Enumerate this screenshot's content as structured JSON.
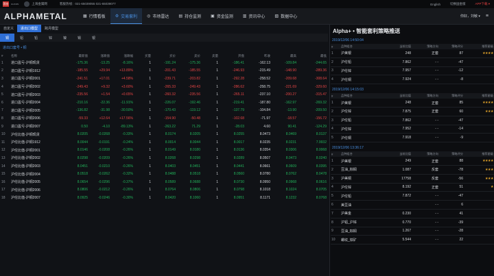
{
  "topbar": {
    "company1": "国金",
    "company1_sub": "GUOJIN",
    "company2": "上海金属网",
    "hotline": "客服热线：021-65039055 021-65039077",
    "lang": "English",
    "switch": "切换国金版",
    "app": "APP下载 ▾"
  },
  "brand": "ALPHAMETAL",
  "nav": [
    {
      "label": "行情看板",
      "icon": "▦"
    },
    {
      "label": "交易套利",
      "icon": "⚙",
      "active": true
    },
    {
      "label": "市场雷达",
      "icon": "◎"
    },
    {
      "label": "持仓监测",
      "icon": "▤"
    },
    {
      "label": "资金监测",
      "icon": "▣"
    },
    {
      "label": "资讯中心",
      "icon": "▥"
    },
    {
      "label": "数据中心",
      "icon": "▧"
    }
  ],
  "user": {
    "greeting": "你好，刘敏 ▾",
    "menu": "≡"
  },
  "tabs1": [
    {
      "label": "自定义"
    },
    {
      "label": "进出口模型",
      "active": true
    },
    {
      "label": "跨月模型"
    }
  ],
  "tabs2": [
    {
      "label": "铜",
      "active": true
    },
    {
      "label": "铝"
    },
    {
      "label": "铅"
    },
    {
      "label": "锌"
    },
    {
      "label": "镍"
    },
    {
      "label": "锡"
    },
    {
      "label": "银"
    }
  ],
  "breadcrumb": "进出口套号 • 铜",
  "table": {
    "headers": [
      "#",
      "名称",
      "最新值",
      "涨跌值",
      "涨跌幅",
      "买量",
      "买价",
      "卖价",
      "卖量",
      "开盘",
      "昨收",
      "最高",
      "最低"
    ],
    "rows": [
      [
        "1",
        "进口盈亏-沪铜现货",
        "-175.36",
        "-13.25",
        "-8.16%",
        "1",
        "-191.24",
        "-175.36",
        "1",
        "-186.41",
        "-162.13",
        "-109.84",
        "-244.65"
      ],
      [
        "2",
        "进口盈亏-沪铜1912",
        "-185.55",
        "+29.94",
        "+13.89%",
        "1",
        "-201.43",
        "-185.55",
        "1",
        "-246.93",
        "-215.49",
        "-148.90",
        "-289.36"
      ],
      [
        "3",
        "进口盈亏-沪铜2001",
        "-241.51",
        "+17.01",
        "+4.58%",
        "1",
        "-239.71",
        "-203.82",
        "1",
        "-292.28",
        "-258.52",
        "-209.68",
        "-308.64"
      ],
      [
        "4",
        "进口盈亏-沪铜2002",
        "-249.43",
        "+9.32",
        "+3.60%",
        "1",
        "-265.33",
        "-249.43",
        "1",
        "-286.62",
        "-258.75",
        "-221.69",
        "-329.60"
      ],
      [
        "5",
        "进口盈亏-沪铜2003",
        "-235.56",
        "+1.54",
        "+0.65%",
        "1",
        "-260.32",
        "-235.56",
        "1",
        "-265.11",
        "-237.10",
        "-200.27",
        "-315.47"
      ],
      [
        "6",
        "进口盈亏-沪铜2004",
        "-210.16",
        "-22.36",
        "-11.91%",
        "1",
        "-226.07",
        "-192.46",
        "1",
        "-219.41",
        "-187.80",
        "-162.97",
        "-269.32"
      ],
      [
        "7",
        "进口盈亏-沪铜2005",
        "-136.82",
        "-31.98",
        "-30.50%",
        "1",
        "-170.43",
        "-119.12",
        "1",
        "-137.79",
        "-104.84",
        "-13.90",
        "-209.50"
      ],
      [
        "8",
        "进口盈亏-沪铜2006",
        "-59.33",
        "+12.64",
        "+17.56%",
        "1",
        "-154.90",
        "-50.48",
        "1",
        "-102.68",
        "-71.97",
        "-18.57",
        "-156.72"
      ],
      [
        "9",
        "进口盈亏-沪铜2007",
        "0.50",
        "-4.10",
        "-89.13%",
        "1",
        "-263.22",
        "71.29",
        "1",
        "-28.03",
        "4.60",
        "90.41",
        "-124.29"
      ],
      [
        "10",
        "沪伦比值-沪铜现货",
        "8.0205",
        "-0.0268",
        "-0.33%",
        "1",
        "8.0174",
        "8.0205",
        "1",
        "8.0255",
        "8.0473",
        "8.0469",
        "8.0137"
      ],
      [
        "11",
        "沪伦比值-沪铜1912",
        "8.0044",
        "-0.0191",
        "-0.24%",
        "1",
        "8.0014",
        "8.0044",
        "1",
        "8.0017",
        "8.0235",
        "8.0231",
        "7.9932"
      ],
      [
        "12",
        "沪伦比值-沪铜2001",
        "8.0146",
        "-0.0208",
        "-0.26%",
        "1",
        "8.0149",
        "8.0180",
        "1",
        "8.0136",
        "8.0354",
        "8.0306",
        "8.0068"
      ],
      [
        "13",
        "沪伦比值-沪铜2002",
        "8.0298",
        "-0.0209",
        "-0.26%",
        "1",
        "8.0268",
        "8.0298",
        "1",
        "8.0289",
        "8.0507",
        "8.0473",
        "8.0240"
      ],
      [
        "14",
        "沪伦比值-沪铜2003",
        "8.0451",
        "-0.0210",
        "-0.26%",
        "1",
        "8.0403",
        "8.0451",
        "1",
        "8.0441",
        "8.0661",
        "8.0609",
        "8.0395"
      ],
      [
        "15",
        "沪伦比值-沪铜2004",
        "8.0518",
        "-0.0262",
        "-0.32%",
        "1",
        "8.0488",
        "8.0518",
        "1",
        "8.0560",
        "8.0780",
        "8.0762",
        "8.0478"
      ],
      [
        "16",
        "沪伦比值-沪铜2005",
        "8.0654",
        "-0.0296",
        "-0.37%",
        "1",
        "8.0589",
        "8.0688",
        "1",
        "8.0730",
        "8.0950",
        "8.0968",
        "8.0616"
      ],
      [
        "17",
        "沪伦比值-沪铜2006",
        "8.0806",
        "-0.0212",
        "-0.26%",
        "1",
        "8.0764",
        "8.0806",
        "1",
        "8.0798",
        "8.1018",
        "8.1024",
        "8.0705"
      ],
      [
        "18",
        "沪伦比值-沪铜2007",
        "8.0925",
        "-0.0246",
        "-0.30%",
        "1",
        "8.0420",
        "8.1060",
        "1",
        "8.0951",
        "8.1171",
        "8.1232",
        "8.0768"
      ]
    ]
  },
  "panel": {
    "title": "Alpha+ • 智能套利策略推送",
    "headers": [
      "#",
      "品种组合",
      "当前比值",
      "策略方向",
      "策略评分",
      "推荐星级"
    ],
    "groups": [
      {
        "time": "2019/12/06 14:50:04",
        "rows": [
          [
            "1",
            "沪美银",
            "248",
            "正套",
            "87",
            4
          ],
          [
            "2",
            "沪伦铅",
            "7.862",
            "- -",
            "-47",
            0
          ],
          [
            "3",
            "沪伦锌",
            "7.957",
            "- -",
            "-12",
            0
          ],
          [
            "4",
            "沪伦铜",
            "7.924",
            "- -",
            "-8",
            0
          ]
        ]
      },
      {
        "time": "2019/12/06 14:15:03",
        "rows": [
          [
            "1",
            "沪美银",
            "248",
            "正套",
            "85",
            4
          ],
          [
            "2",
            "沪伦锌",
            "7.875",
            "正套",
            "60",
            3
          ],
          [
            "3",
            "沪伦铅",
            "7.862",
            "- -",
            "-47",
            0
          ],
          [
            "4",
            "沪伦锌",
            "7.952",
            "- -",
            "-14",
            0
          ],
          [
            "5",
            "沪伦铜",
            "7.918",
            "- -",
            "-9",
            0
          ]
        ]
      },
      {
        "time": "2019/12/06 13:36:17",
        "rows": [
          [
            "1",
            "沪美银",
            "249",
            "正套",
            "88",
            4
          ],
          [
            "2",
            "豆油_棕榈",
            "1.087",
            "反套",
            "-78",
            3
          ],
          [
            "3",
            "沪美铜",
            "17758",
            "反套",
            "-56",
            3
          ],
          [
            "4",
            "沪伦锌",
            "8.192",
            "正套",
            "51",
            1
          ],
          [
            "5",
            "沪伦铅",
            "7.872",
            "- -",
            "-47",
            0
          ],
          [
            "6",
            "美豆油",
            "",
            "- -",
            "6",
            0
          ],
          [
            "7",
            "沪美金",
            "0.230",
            "- -",
            "41",
            0
          ],
          [
            "8",
            "沪铝_沪锌",
            "0.770",
            "- -",
            "-39",
            0
          ],
          [
            "9",
            "豆油_棕榈",
            "1.267",
            "- -",
            "-28",
            0
          ],
          [
            "10",
            "螺纹_铁矿",
            "5.544",
            "- -",
            "22",
            0
          ]
        ]
      }
    ]
  },
  "colors": {
    "up": "#e84545",
    "down": "#22b35b",
    "accent": "#4a90e2",
    "tab_active": "#2f6fd6",
    "star": "#e0a22a"
  }
}
